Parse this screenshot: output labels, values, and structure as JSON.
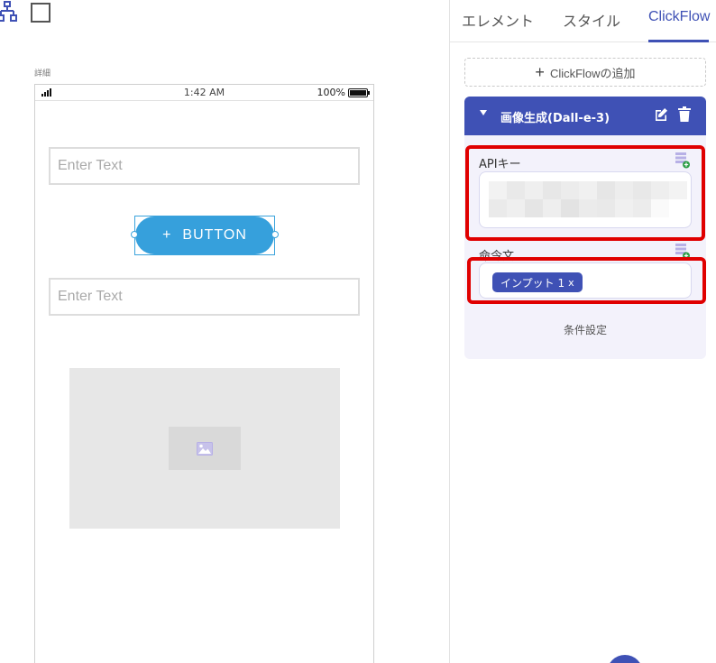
{
  "canvas": {
    "detail_label": "詳細",
    "status_bar": {
      "time": "1:42 AM",
      "battery": "100%"
    },
    "inputs": [
      {
        "placeholder": "Enter Text"
      },
      {
        "placeholder": "Enter Text"
      }
    ],
    "button": {
      "icon": "plus-icon",
      "label": "BUTTON"
    },
    "image_placeholder": {
      "icon": "image-icon"
    }
  },
  "panel": {
    "tabs": [
      {
        "label": "エレメント",
        "active": false
      },
      {
        "label": "スタイル",
        "active": false
      },
      {
        "label": "ClickFlow",
        "active": true
      }
    ],
    "add_clickflow": {
      "plus": "+",
      "label": "ClickFlowの追加"
    },
    "flow_card": {
      "title": "画像生成(Dall-e-3)",
      "fields": {
        "api_key": {
          "label": "APIキー",
          "value_state": "blurred"
        },
        "prompt": {
          "label": "命令文",
          "chip": {
            "label": "インプット 1",
            "remove": "x"
          }
        }
      },
      "condition_label": "条件設定"
    }
  },
  "colors": {
    "accent": "#3f51b5",
    "button_blue": "#36a0dc",
    "highlight_red": "#e00000",
    "card_bg": "#f3f2fb"
  }
}
